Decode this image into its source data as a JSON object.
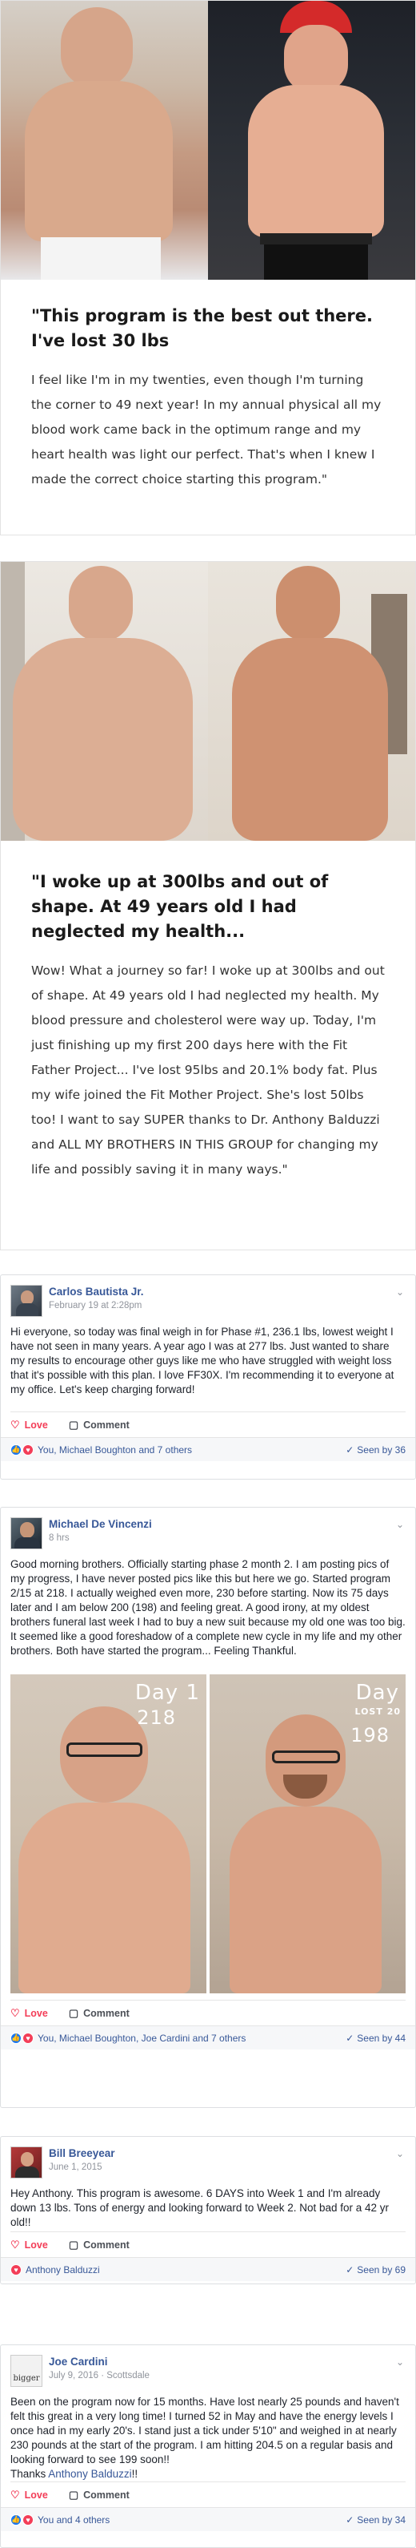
{
  "testimonial1": {
    "quote": "\"This program is the best out there. I've lost 30 lbs",
    "body": "I feel like I'm in my twenties, even though I'm turning the corner to 49 next year! In my annual physical all my blood work came back in the optimum range and my heart health was light our perfect. That's when I knew I made the correct choice starting this program.\""
  },
  "testimonial2": {
    "quote": "\"I woke up at 300lbs and out of shape. At 49 years old I had neglected my health...",
    "body": "Wow! What a journey so far! I woke up at 300lbs and out of shape. At 49 years old I had neglected my health. My blood pressure and cholesterol were way up. Today, I'm just finishing up my first 200 days here with the Fit Father Project... I've lost 95lbs and 20.1% body fat. Plus my wife joined the Fit Mother Project. She's lost 50lbs too! I want to say SUPER thanks to Dr. Anthony Balduzzi and ALL MY BROTHERS IN THIS GROUP for changing my life and possibly saving it in many ways.\""
  },
  "post1": {
    "name": "Carlos Bautista Jr.",
    "date": "February 19 at 2:28pm",
    "text": "Hi everyone, so today was final weigh in for Phase #1, 236.1 lbs, lowest weight I have not seen in many years. A year ago I was at 277 lbs. Just wanted to share my results to encourage other guys like me who have struggled with weight loss that it's possible with this plan. I love FF30X. I'm recommending it to everyone at my office. Let's keep charging forward!",
    "love": "Love",
    "comment": "Comment",
    "reactions": "You, Michael Boughton and 7 others",
    "seen": "Seen by 36"
  },
  "post2": {
    "name": "Michael De Vincenzi",
    "date": "8 hrs",
    "text": "Good morning brothers. Officially starting phase 2 month 2. I am posting pics of my progress, I have never posted pics like this but here we go. Started program 2/15 at 218. I actually weighed even more, 230 before starting. Now its 75 days later and I am below 200 (198) and feeling great. A good irony, at my oldest brothers funeral last week I had to buy a new suit because my old one was too big. It seemed like a good foreshadow of a complete new cycle in my life and my other brothers. Both have started the program... Feeling Thankful.",
    "photo_left_day": "Day 1",
    "photo_left_weight": "218",
    "photo_right_day": "Day",
    "photo_right_sub": "LOST 20",
    "photo_right_weight": "198",
    "love": "Love",
    "comment": "Comment",
    "reactions": "You, Michael Boughton, Joe Cardini and 7 others",
    "seen": "Seen by 44"
  },
  "post3": {
    "name": "Bill Breeyear",
    "date": "June 1, 2015",
    "text": "Hey Anthony. This program is awesome. 6 DAYS into Week 1 and I'm already down 13 lbs. Tons of energy and looking forward to Week 2. Not bad for a 42 yr old!!",
    "love": "Love",
    "comment": "Comment",
    "reactions": "Anthony Balduzzi",
    "seen": "Seen by 69"
  },
  "post4": {
    "name": "Joe Cardini",
    "date": "July 9, 2016 · Scottsdale",
    "text": "Been on the program now for 15 months. Have lost nearly 25 pounds and haven't felt this great in a very long time! I turned 52 in May and have the energy levels I once had in my early 20's. I stand just a tick under 5'10\" and weighed in at nearly 230 pounds at the start of the program. I am hitting 204.5 on a regular basis and looking forward to see 199 soon!!",
    "thanks": "Thanks ",
    "mention": "Anthony Balduzzi",
    "thanks_end": "!!",
    "avatar_text": "bigger",
    "love": "Love",
    "comment": "Comment",
    "reactions": "You and 4 others",
    "seen": "Seen by 34"
  },
  "colors": {
    "fb_blue": "#385898",
    "love_red": "#f33e58",
    "like_blue": "#1877f2"
  }
}
